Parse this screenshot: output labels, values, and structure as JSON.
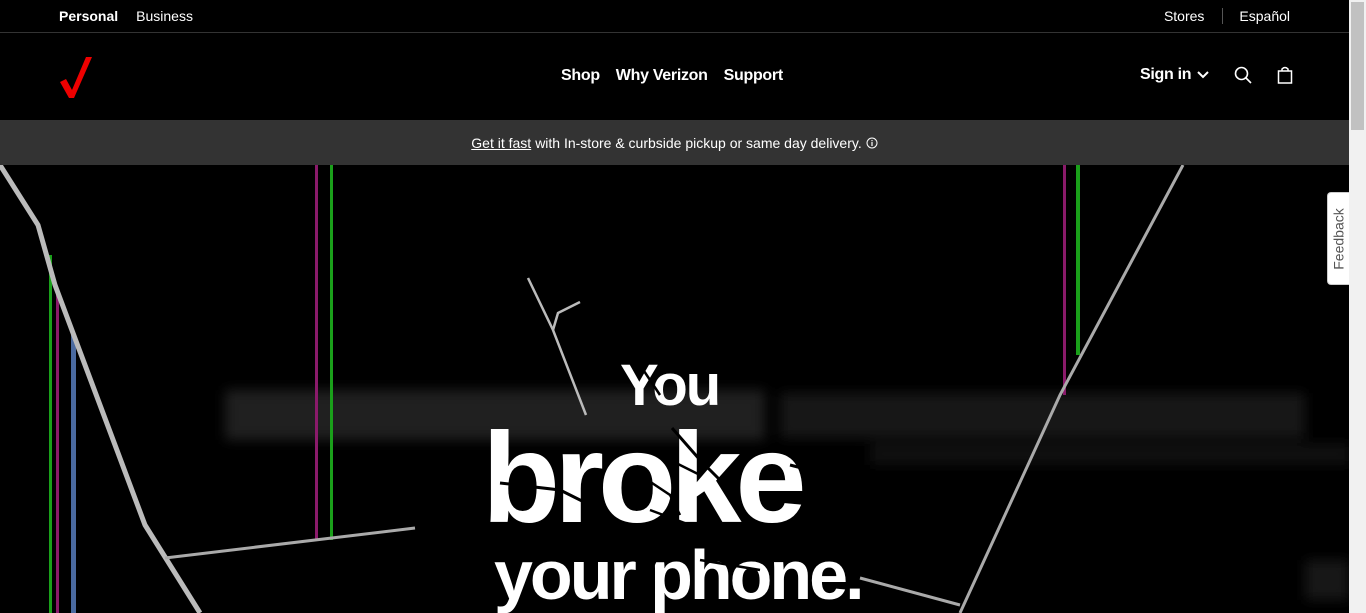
{
  "utility": {
    "segments": [
      "Personal",
      "Business"
    ],
    "stores": "Stores",
    "language": "Español"
  },
  "nav": {
    "links": [
      "Shop",
      "Why Verizon",
      "Support"
    ],
    "signin": "Sign in"
  },
  "promo": {
    "link": "Get it fast",
    "text": "with In-store & curbside pickup or same day delivery."
  },
  "hero": {
    "line1": "You",
    "line2": "broke",
    "line3": "your phone."
  },
  "feedback": "Feedback",
  "colors": {
    "brand_red": "#ee0000",
    "promo_bg": "#333333"
  },
  "icons": [
    "verizon-check-logo",
    "chevron-down-icon",
    "search-icon",
    "bag-icon",
    "info-icon"
  ]
}
